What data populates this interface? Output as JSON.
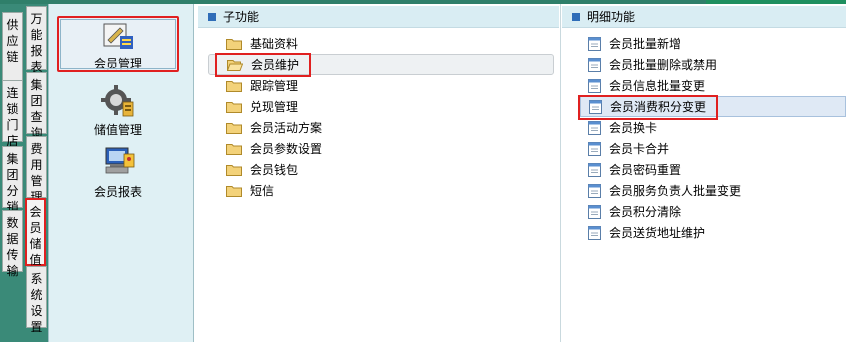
{
  "left_tabs": [
    {
      "label": "供应链"
    },
    {
      "label": "万能报表"
    },
    {
      "label": "连锁门店"
    },
    {
      "label": "集团查询"
    },
    {
      "label": "集团分销"
    },
    {
      "label": "费用管理"
    },
    {
      "label": "数据传输"
    },
    {
      "label": "会员储值",
      "selected": true
    },
    {
      "label": "系统设置"
    }
  ],
  "modules": [
    {
      "label": "会员管理",
      "icon": "member-management-icon",
      "selected": true
    },
    {
      "label": "储值管理",
      "icon": "stored-value-gear-icon"
    },
    {
      "label": "会员报表",
      "icon": "member-report-icon"
    }
  ],
  "sub_panel": {
    "title": "子功能",
    "items": [
      {
        "label": "基础资料"
      },
      {
        "label": "会员维护",
        "selected": true
      },
      {
        "label": "跟踪管理"
      },
      {
        "label": "兑现管理"
      },
      {
        "label": "会员活动方案"
      },
      {
        "label": "会员参数设置"
      },
      {
        "label": "会员钱包"
      },
      {
        "label": "短信"
      }
    ]
  },
  "detail_panel": {
    "title": "明细功能",
    "items": [
      {
        "label": "会员批量新增"
      },
      {
        "label": "会员批量删除或禁用"
      },
      {
        "label": "会员信息批量变更"
      },
      {
        "label": "会员消费积分变更",
        "highlighted": true
      },
      {
        "label": "会员换卡"
      },
      {
        "label": "会员卡合并"
      },
      {
        "label": "会员密码重置"
      },
      {
        "label": "会员服务负责人批量变更"
      },
      {
        "label": "会员积分清除"
      },
      {
        "label": "会员送货地址维护"
      }
    ]
  },
  "colors": {
    "accent_red": "#e02020",
    "panel_header": "#d9edf3",
    "module_bg": "#dff0f4",
    "tab_strip": "#3a8a78"
  }
}
